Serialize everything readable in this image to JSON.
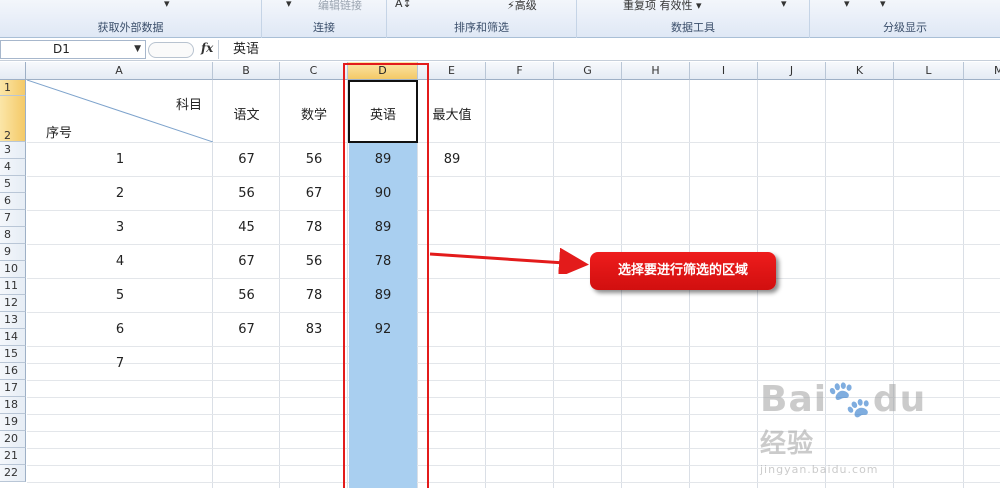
{
  "ribbon": {
    "groups": [
      {
        "label": "获取外部数据"
      },
      {
        "label": "连接",
        "item": "编辑链接"
      },
      {
        "label": "排序和筛选",
        "item": "高级"
      },
      {
        "label": "数据工具",
        "item": "重复项 有效性 ▾"
      },
      {
        "label": "分级显示"
      }
    ]
  },
  "formula_bar": {
    "name_box": "D1",
    "fx": "fx",
    "content": "英语"
  },
  "columns": [
    "A",
    "B",
    "C",
    "D",
    "E",
    "F",
    "G",
    "H",
    "I",
    "J",
    "K",
    "L",
    "M"
  ],
  "selected_column": "D",
  "rows": [
    "1",
    "2",
    "3",
    "4",
    "5",
    "6",
    "7",
    "8",
    "9",
    "10",
    "11",
    "12",
    "13",
    "14",
    "15",
    "16",
    "17",
    "18",
    "19",
    "20",
    "21",
    "22"
  ],
  "header_cell": {
    "subject": "科目",
    "index": "序号"
  },
  "col_headers": {
    "b": "语文",
    "c": "数学",
    "d": "英语",
    "e": "最大值"
  },
  "table": [
    {
      "index": "1",
      "chinese": "67",
      "math": "56",
      "english": "89",
      "max": "89"
    },
    {
      "index": "2",
      "chinese": "56",
      "math": "67",
      "english": "90"
    },
    {
      "index": "3",
      "chinese": "45",
      "math": "78",
      "english": "89"
    },
    {
      "index": "4",
      "chinese": "67",
      "math": "56",
      "english": "78"
    },
    {
      "index": "5",
      "chinese": "56",
      "math": "78",
      "english": "89"
    },
    {
      "index": "6",
      "chinese": "67",
      "math": "83",
      "english": "92"
    },
    {
      "index": "7"
    }
  ],
  "annotation": {
    "callout_text": "选择要进行筛选的区域",
    "color": "#e31b1b"
  },
  "watermark": {
    "brand": "Bai",
    "brand2": "du",
    "cn": "经验",
    "url": "jingyan.baidu.com"
  },
  "colors": {
    "selection_fill": "#a9cff0",
    "header_selected": "#f4c967",
    "accent_red": "#e31b1b"
  }
}
